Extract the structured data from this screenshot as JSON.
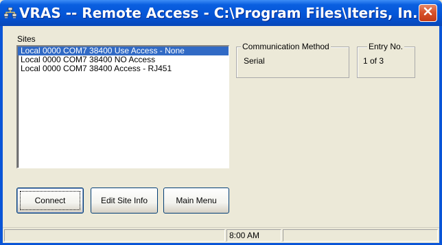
{
  "window": {
    "title": "VRAS -- Remote Access - C:\\Program Files\\Iteris, In...",
    "app_icon": "network-computers-icon",
    "close_icon": "close-x-icon",
    "colors": {
      "titlebar": "#0454d6",
      "close": "#d9542c",
      "selection": "#316ac5",
      "face": "#ece9d8"
    }
  },
  "sites": {
    "label": "Sites",
    "items": [
      {
        "label": "Local 0000 COM7 38400 Use Access - None",
        "selected": true
      },
      {
        "label": "Local 0000 COM7 38400 NO Access",
        "selected": false
      },
      {
        "label": "Local 0000 COM7 38400 Access - RJ451",
        "selected": false
      }
    ]
  },
  "communication_method": {
    "title": "Communication Method",
    "value": "Serial"
  },
  "entry": {
    "title": "Entry No.",
    "value": "1 of 3"
  },
  "buttons": {
    "connect": "Connect",
    "edit_site_info": "Edit Site Info",
    "main_menu": "Main Menu"
  },
  "status": {
    "panes": [
      "",
      "8:00 AM",
      ""
    ]
  }
}
